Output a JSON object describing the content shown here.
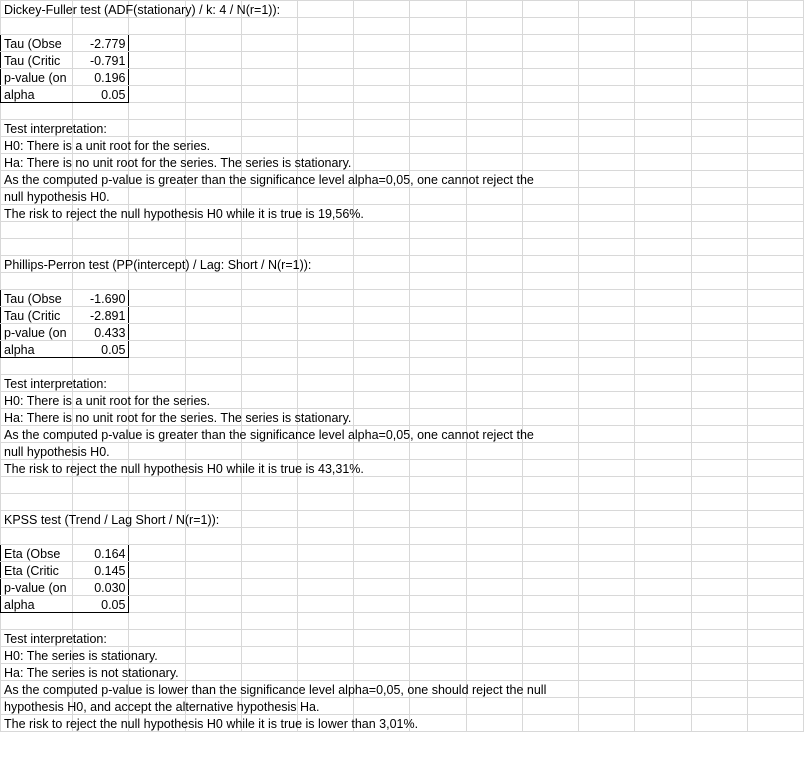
{
  "colCount": 14,
  "tests": [
    {
      "title": "Dickey-Fuller test (ADF(stationary) / k: 4 / N(r=1)):",
      "stats": [
        {
          "label": "Tau (Obse",
          "value": "-2.779"
        },
        {
          "label": "Tau (Critic",
          "value": "-0.791"
        },
        {
          "label": "p-value (on",
          "value": "0.196"
        },
        {
          "label": "alpha",
          "value": "0.05"
        }
      ],
      "interpHeader": "Test interpretation:",
      "interp": [
        "H0: There is a unit root for the series.",
        "Ha: There is no unit root for the series. The series is stationary.",
        "As the computed p-value is greater than the significance level alpha=0,05, one cannot reject the",
        "null hypothesis H0.",
        "The risk to reject the null hypothesis H0 while it is true is 19,56%."
      ]
    },
    {
      "title": "Phillips-Perron test (PP(intercept) / Lag: Short / N(r=1)):",
      "stats": [
        {
          "label": "Tau (Obse",
          "value": "-1.690"
        },
        {
          "label": "Tau (Critic",
          "value": "-2.891"
        },
        {
          "label": "p-value (on",
          "value": "0.433"
        },
        {
          "label": "alpha",
          "value": "0.05"
        }
      ],
      "interpHeader": "Test interpretation:",
      "interp": [
        "H0: There is a unit root for the series.",
        "Ha: There is no unit root for the series. The series is stationary.",
        "As the computed p-value is greater than the significance level alpha=0,05, one cannot reject the",
        "null hypothesis H0.",
        "The risk to reject the null hypothesis H0 while it is true is 43,31%."
      ]
    },
    {
      "title": "KPSS test (Trend / Lag Short / N(r=1)):",
      "stats": [
        {
          "label": "Eta (Obse",
          "value": "0.164"
        },
        {
          "label": "Eta (Critic",
          "value": "0.145"
        },
        {
          "label": "p-value (on",
          "value": "0.030"
        },
        {
          "label": "alpha",
          "value": "0.05"
        }
      ],
      "interpHeader": "Test interpretation:",
      "interp": [
        "H0: The series is stationary.",
        "Ha: The series is not stationary.",
        "As the computed p-value is lower than the significance level alpha=0,05, one should reject the null",
        "hypothesis H0, and accept the alternative hypothesis Ha.",
        "The risk to reject the null hypothesis H0 while it is true is lower than 3,01%."
      ]
    }
  ]
}
